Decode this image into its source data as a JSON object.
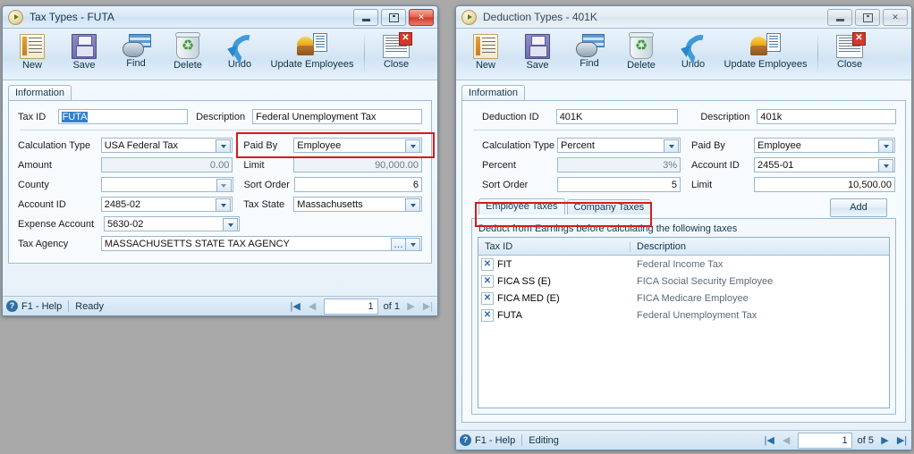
{
  "toolbar_buttons": [
    "New",
    "Save",
    "Find",
    "Delete",
    "Undo",
    "Update Employees",
    "Close"
  ],
  "left_window": {
    "title": "Tax Types - FUTA",
    "tab": "Information",
    "toolbar": {
      "new": "New",
      "save": "Save",
      "find": "Find",
      "delete": "Delete",
      "undo": "Undo",
      "update_employees": "Update Employees",
      "close": "Close"
    },
    "fields": {
      "tax_id_label": "Tax ID",
      "tax_id_value": "FUTA",
      "description_label": "Description",
      "description_value": "Federal Unemployment Tax",
      "calculation_type_label": "Calculation Type",
      "calculation_type_value": "USA Federal Tax",
      "paid_by_label": "Paid By",
      "paid_by_value": "Employee",
      "amount_label": "Amount",
      "amount_value": "0.00",
      "limit_label": "Limit",
      "limit_value": "90,000.00",
      "county_label": "County",
      "county_value": "",
      "sort_order_label": "Sort Order",
      "sort_order_value": "6",
      "account_id_label": "Account ID",
      "account_id_value": "2485-02",
      "tax_state_label": "Tax State",
      "tax_state_value": "Massachusetts",
      "expense_account_label": "Expense Account",
      "expense_account_value": "5630-02",
      "tax_agency_label": "Tax Agency",
      "tax_agency_value": "MASSACHUSETTS STATE TAX AGENCY"
    },
    "status": {
      "help": "F1 - Help",
      "state": "Ready",
      "page": "1",
      "of": "of 1"
    }
  },
  "right_window": {
    "title": "Deduction Types - 401K",
    "tab": "Information",
    "toolbar": {
      "new": "New",
      "save": "Save",
      "find": "Find",
      "delete": "Delete",
      "undo": "Undo",
      "update_employees": "Update Employees",
      "close": "Close"
    },
    "fields": {
      "deduction_id_label": "Deduction ID",
      "deduction_id_value": "401K",
      "description_label": "Description",
      "description_value": "401k",
      "calculation_type_label": "Calculation Type",
      "calculation_type_value": "Percent",
      "paid_by_label": "Paid By",
      "paid_by_value": "Employee",
      "percent_label": "Percent",
      "percent_value": "3%",
      "account_id_label": "Account ID",
      "account_id_value": "2455-01",
      "sort_order_label": "Sort Order",
      "sort_order_value": "5",
      "limit_label": "Limit",
      "limit_value": "10,500.00"
    },
    "tabs": [
      "Employee Taxes",
      "Company Taxes"
    ],
    "add_button": "Add",
    "grid_note": "Deduct from Earnings before calculating the following taxes",
    "grid_headers": [
      "Tax ID",
      "Description"
    ],
    "grid_rows": [
      {
        "tax_id": "FIT",
        "description": "Federal Income Tax"
      },
      {
        "tax_id": "FICA SS (E)",
        "description": "FICA Social Security Employee"
      },
      {
        "tax_id": "FICA MED (E)",
        "description": "FICA Medicare Employee"
      },
      {
        "tax_id": "FUTA",
        "description": "Federal Unemployment Tax"
      }
    ],
    "status": {
      "help": "F1 - Help",
      "state": "Editing",
      "page": "1",
      "of": "of 5"
    }
  },
  "icons": {
    "remove_row": "✕",
    "help": "?",
    "first": "|◀",
    "prev": "◀",
    "next": "▶",
    "last": "▶|"
  },
  "colors": {
    "highlight_box": "#d51b1b",
    "selection": "#2f7fd0",
    "desktop": "#a9a9a9"
  }
}
